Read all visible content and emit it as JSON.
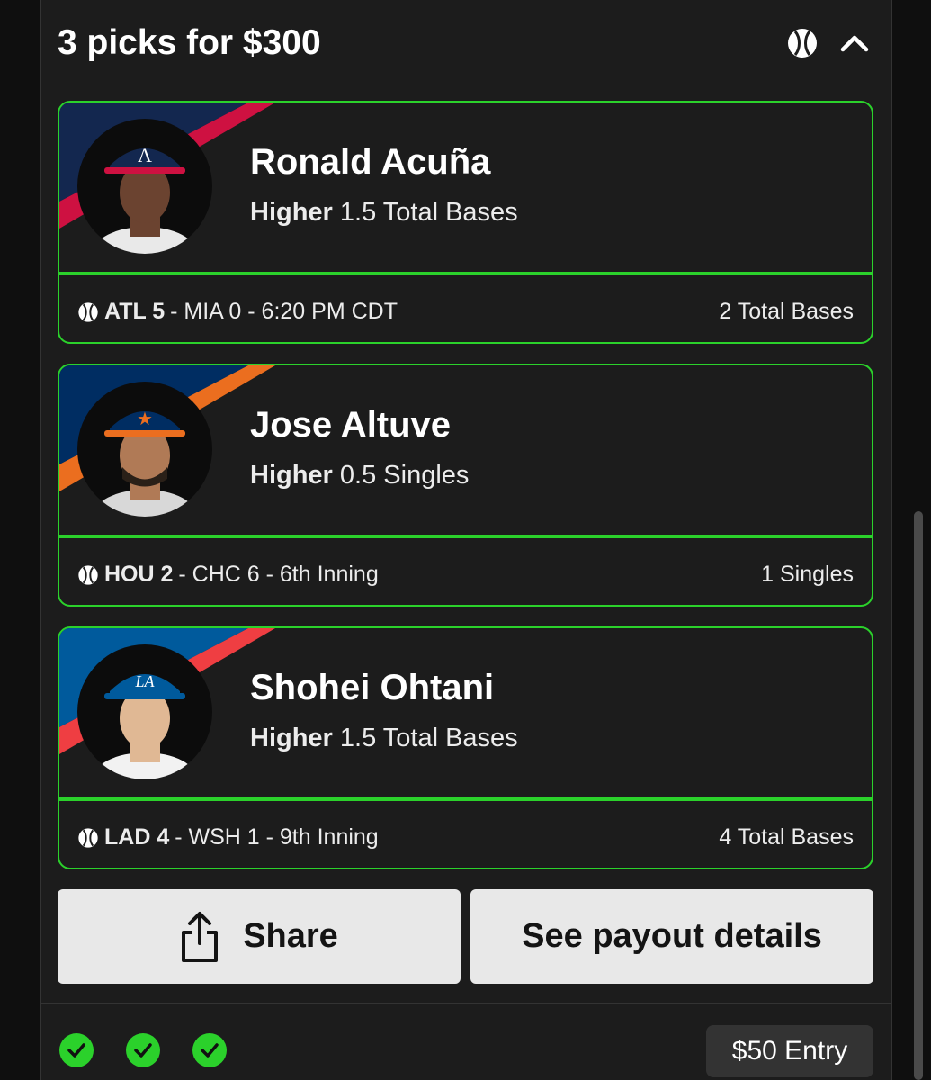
{
  "header": {
    "title": "3 picks for $300",
    "icons": [
      "baseball-icon",
      "chevron-up-icon"
    ]
  },
  "picks": [
    {
      "player": "Ronald Acuña",
      "direction": "Higher",
      "line": "1.5 Total Bases",
      "team_abbr": "ATL 5",
      "game_rest": "- MIA 0 - 6:20 PM CDT",
      "result": "2 Total Bases",
      "stripe_colors": [
        "#13274f",
        "#ce1141"
      ]
    },
    {
      "player": "Jose Altuve",
      "direction": "Higher",
      "line": "0.5 Singles",
      "team_abbr": "HOU 2",
      "game_rest": "- CHC 6 - 6th Inning",
      "result": "1 Singles",
      "stripe_colors": [
        "#002d62",
        "#eb6e1f"
      ]
    },
    {
      "player": "Shohei Ohtani",
      "direction": "Higher",
      "line": "1.5 Total Bases",
      "team_abbr": "LAD 4",
      "game_rest": "- WSH 1 - 9th Inning",
      "result": "4 Total Bases",
      "stripe_colors": [
        "#005a9c",
        "#ef3e42"
      ]
    }
  ],
  "actions": {
    "share_label": "Share",
    "payout_label": "See payout details"
  },
  "footer": {
    "checks": [
      "check-icon",
      "check-icon",
      "check-icon"
    ],
    "entry_label": "$50 Entry"
  },
  "colors": {
    "accent_green": "#2bd12b",
    "panel_bg": "#1c1c1c",
    "button_bg": "#e8e8e8"
  }
}
